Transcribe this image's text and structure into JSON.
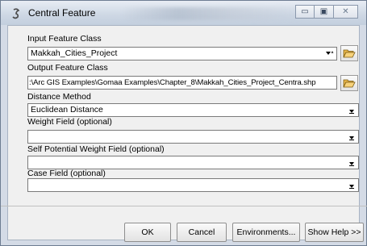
{
  "window": {
    "title": "Central Feature",
    "minimize_glyph": "▭",
    "maximize_glyph": "▣",
    "close_glyph": "✕"
  },
  "form": {
    "input_feature_class": {
      "label": "Input Feature Class",
      "value": "Makkah_Cities_Project"
    },
    "output_feature_class": {
      "label": "Output Feature Class",
      "value": ":\\Arc GIS Examples\\Gomaa Examples\\Chapter_8\\Makkah_Cities_Project_Centra.shp"
    },
    "distance_method": {
      "label": "Distance Method",
      "value": "Euclidean Distance"
    },
    "weight_field": {
      "label": "Weight Field (optional)",
      "value": ""
    },
    "self_potential_weight_field": {
      "label": "Self Potential Weight Field (optional)",
      "value": ""
    },
    "case_field": {
      "label": "Case Field (optional)",
      "value": ""
    }
  },
  "buttons": {
    "ok": "OK",
    "cancel": "Cancel",
    "environments": "Environments...",
    "show_help": "Show Help >>"
  },
  "icons": {
    "title": "tool-icon",
    "browse": "folder-open-icon"
  }
}
